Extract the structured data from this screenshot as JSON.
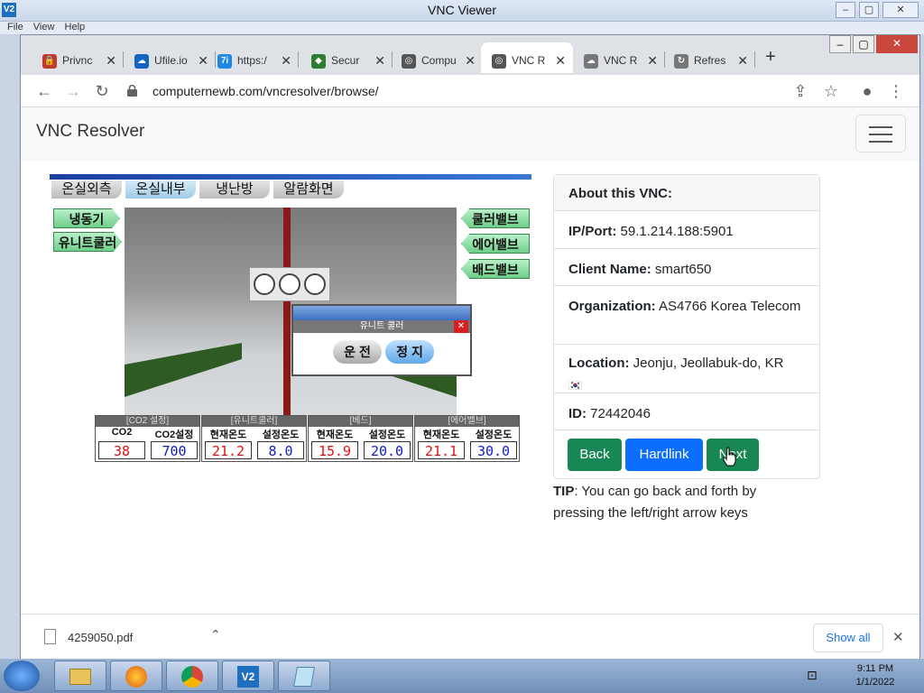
{
  "vnc": {
    "title": "VNC Viewer",
    "icon": "V2",
    "menu": [
      "File",
      "View",
      "Help"
    ]
  },
  "browser": {
    "tabs": [
      {
        "label": "Privnc",
        "icon": "lock-red-icon",
        "color": "#c0392b"
      },
      {
        "label": "Ufile.io",
        "icon": "cloud-icon",
        "color": "#1565c0"
      },
      {
        "label": "https:/",
        "icon": "seven-icon",
        "color": "#1e88e5",
        "glyph": "7i"
      },
      {
        "label": "Secur",
        "icon": "shield-green-icon",
        "color": "#2e7d32"
      },
      {
        "label": "Compu",
        "icon": "globe-icon",
        "color": "#555555"
      },
      {
        "label": "VNC R",
        "icon": "globe-icon",
        "color": "#555555"
      },
      {
        "label": "VNC R",
        "icon": "cloud-icon",
        "color": "#777777"
      },
      {
        "label": "Refres",
        "icon": "refresh-icon",
        "color": "#777777"
      }
    ],
    "active_tab": 5,
    "url": "computernewb.com/vncresolver/browse/"
  },
  "page": {
    "brand": "VNC Resolver",
    "screenshot": {
      "tabs": [
        "온실외측",
        "온실내부",
        "냉난방",
        "알람화면"
      ],
      "left_buttons": [
        "냉동기",
        "유니트쿨러"
      ],
      "right_buttons": [
        "쿨러밸브",
        "에어밸브",
        "배드밸브"
      ],
      "popup": {
        "title": "유니트 쿨러",
        "run": "운 전",
        "stop": "정 지"
      },
      "groups": [
        {
          "head": "[CO2 설정]",
          "cols": [
            {
              "label": "CO2",
              "value": "38"
            },
            {
              "label": "CO2설정",
              "value": "700"
            }
          ]
        },
        {
          "head": "[유니트쿨러]",
          "cols": [
            {
              "label": "현재온도",
              "value": "21.2"
            },
            {
              "label": "설정온도",
              "value": "8.0"
            }
          ]
        },
        {
          "head": "[베드]",
          "cols": [
            {
              "label": "현재온도",
              "value": "15.9"
            },
            {
              "label": "설정온도",
              "value": "20.0"
            }
          ]
        },
        {
          "head": "[에어밸브]",
          "cols": [
            {
              "label": "현재온도",
              "value": "21.1"
            },
            {
              "label": "설정온도",
              "value": "30.0"
            }
          ]
        }
      ]
    },
    "card": {
      "title": "About this VNC:",
      "ip_label": "IP/Port:",
      "ip": "59.1.214.188:5901",
      "client_label": "Client Name:",
      "client": "smart650",
      "org_label": "Organization:",
      "org": "AS4766 Korea Telecom",
      "loc_label": "Location:",
      "loc": "Jeonju, Jeollabuk-do, KR",
      "flag": "🇰🇷",
      "id_label": "ID:",
      "id": "72442046",
      "back": "Back",
      "hardlink": "Hardlink",
      "next": "Next"
    },
    "tip_label": "TIP",
    "tip": ": You can go back and forth by pressing the left/right arrow keys"
  },
  "downloads": {
    "file": "4259050.pdf",
    "show_all": "Show all"
  },
  "taskbar": {
    "time": "9:11 PM",
    "date": "1/1/2022",
    "vnc_icon": "V2"
  },
  "colors": {
    "green": "#198754",
    "blue": "#0d6efd",
    "red_digit": "#e01010",
    "blue_digit": "#1020c0"
  }
}
